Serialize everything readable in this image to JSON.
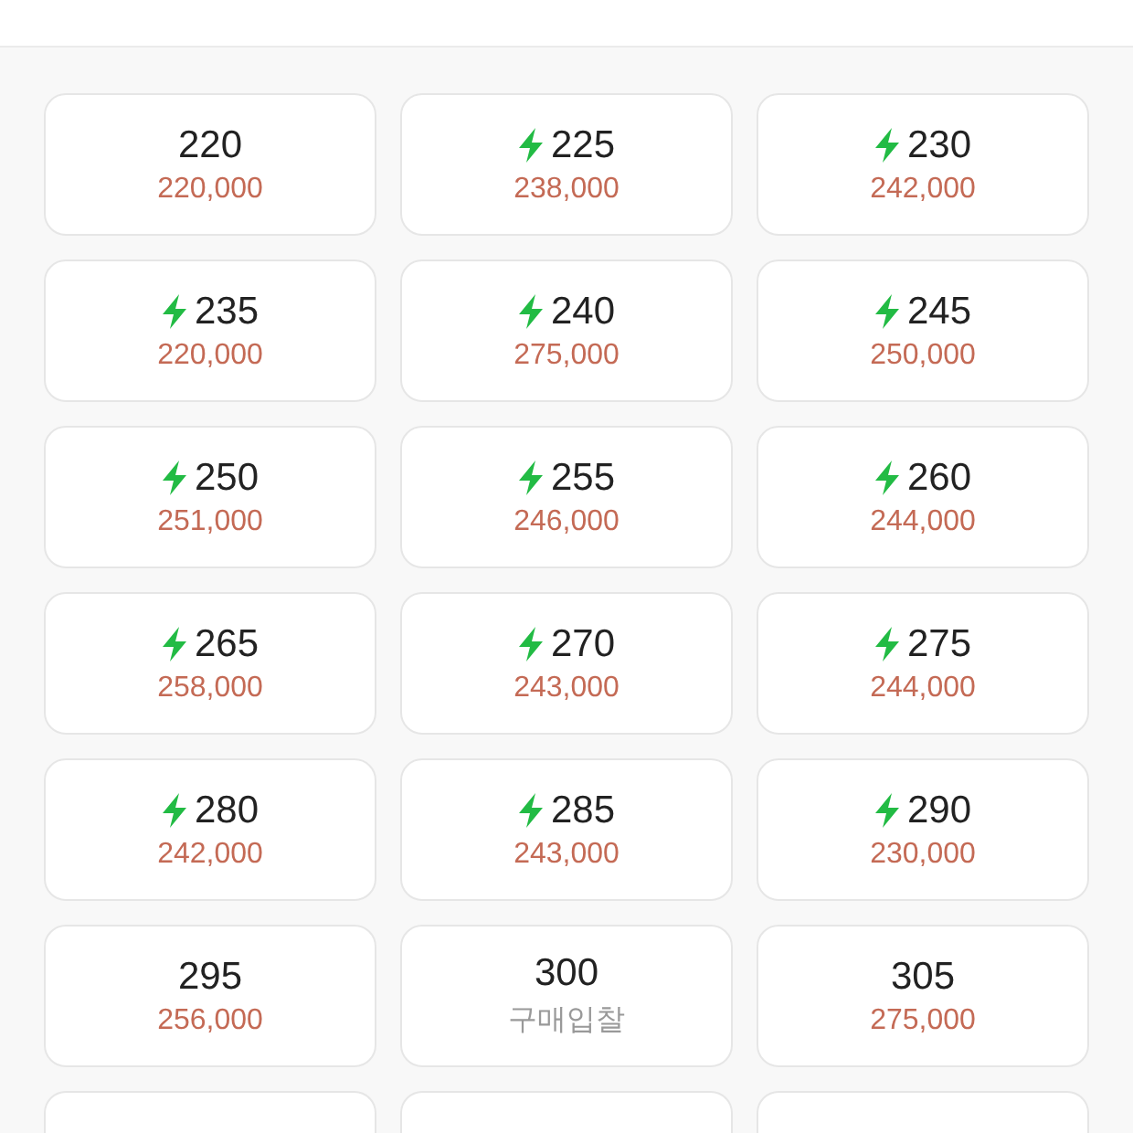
{
  "sizes": [
    {
      "kind": "full",
      "size": "220",
      "fast": false,
      "price": "220,000",
      "bid": false
    },
    {
      "kind": "full",
      "size": "225",
      "fast": true,
      "price": "238,000",
      "bid": false
    },
    {
      "kind": "full",
      "size": "230",
      "fast": true,
      "price": "242,000",
      "bid": false
    },
    {
      "kind": "full",
      "size": "235",
      "fast": true,
      "price": "220,000",
      "bid": false
    },
    {
      "kind": "full",
      "size": "240",
      "fast": true,
      "price": "275,000",
      "bid": false
    },
    {
      "kind": "full",
      "size": "245",
      "fast": true,
      "price": "250,000",
      "bid": false
    },
    {
      "kind": "full",
      "size": "250",
      "fast": true,
      "price": "251,000",
      "bid": false
    },
    {
      "kind": "full",
      "size": "255",
      "fast": true,
      "price": "246,000",
      "bid": false
    },
    {
      "kind": "full",
      "size": "260",
      "fast": true,
      "price": "244,000",
      "bid": false
    },
    {
      "kind": "full",
      "size": "265",
      "fast": true,
      "price": "258,000",
      "bid": false
    },
    {
      "kind": "full",
      "size": "270",
      "fast": true,
      "price": "243,000",
      "bid": false
    },
    {
      "kind": "full",
      "size": "275",
      "fast": true,
      "price": "244,000",
      "bid": false
    },
    {
      "kind": "full",
      "size": "280",
      "fast": true,
      "price": "242,000",
      "bid": false
    },
    {
      "kind": "full",
      "size": "285",
      "fast": true,
      "price": "243,000",
      "bid": false
    },
    {
      "kind": "full",
      "size": "290",
      "fast": true,
      "price": "230,000",
      "bid": false
    },
    {
      "kind": "full",
      "size": "295",
      "fast": false,
      "price": "256,000",
      "bid": false
    },
    {
      "kind": "full",
      "size": "300",
      "fast": false,
      "price": "구매입찰",
      "bid": true
    },
    {
      "kind": "full",
      "size": "305",
      "fast": false,
      "price": "275,000",
      "bid": false
    },
    {
      "kind": "cut"
    },
    {
      "kind": "cut"
    },
    {
      "kind": "cut"
    }
  ]
}
